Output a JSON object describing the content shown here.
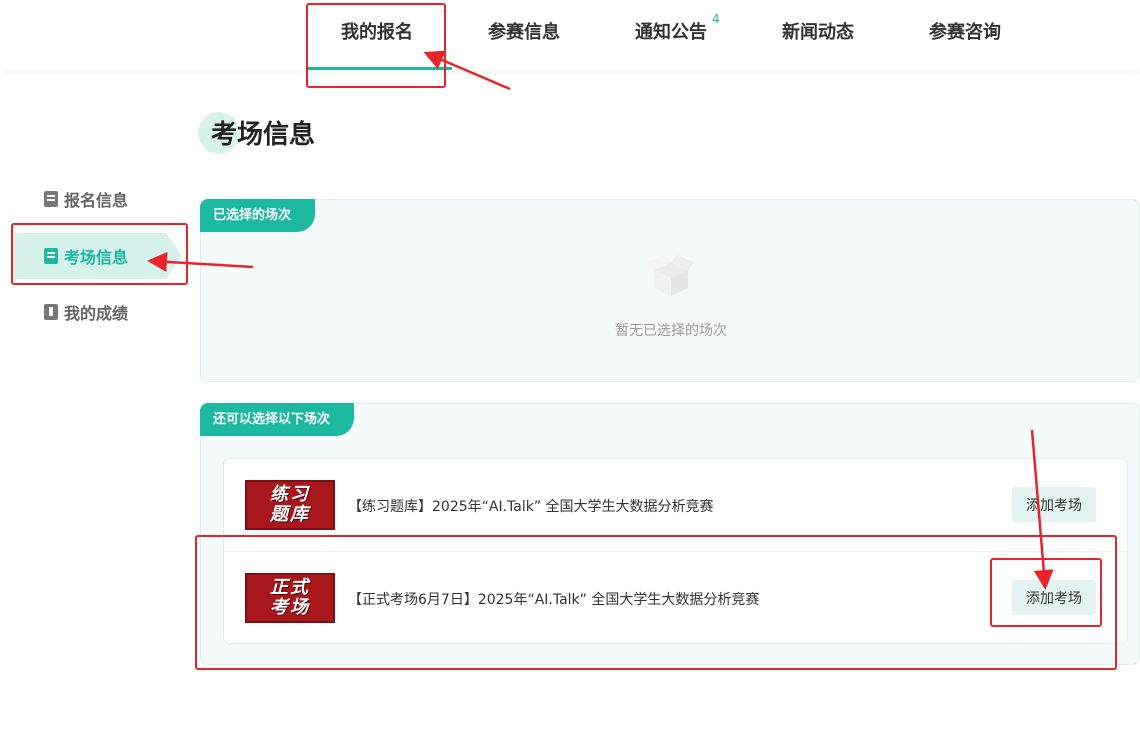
{
  "nav": {
    "items": [
      "我的报名",
      "参赛信息",
      "通知公告",
      "新闻动态",
      "参赛咨询"
    ],
    "active_index": 0,
    "badge": "4"
  },
  "page_title": "考场信息",
  "sidebar": {
    "items": [
      {
        "label": "报名信息",
        "icon": "edit-doc-icon"
      },
      {
        "label": "考场信息",
        "icon": "doc-icon"
      },
      {
        "label": "我的成绩",
        "icon": "score-icon"
      }
    ],
    "active_index": 1
  },
  "selected_panel": {
    "tag": "已选择的场次",
    "empty_text": "暂无已选择的场次"
  },
  "available_panel": {
    "tag": "还可以选择以下场次",
    "rows": [
      {
        "thumb_line1": "练习",
        "thumb_line2": "题库",
        "title": "【练习题库】2025年“AI.Talk” 全国大学生大数据分析竞赛",
        "button": "添加考场"
      },
      {
        "thumb_line1": "正式",
        "thumb_line2": "考场",
        "title": "【正式考场6月7日】2025年“AI.Talk” 全国大学生大数据分析竞赛",
        "button": "添加考场"
      }
    ]
  },
  "colors": {
    "accent": "#1cb8a0",
    "annotation": "#e8232a",
    "thumb_red": "#a8171c"
  }
}
